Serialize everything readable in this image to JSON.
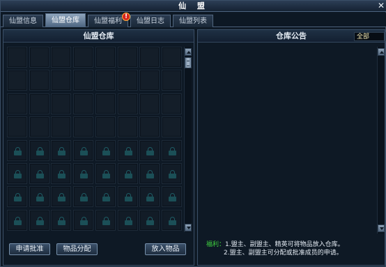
{
  "window": {
    "title": "仙 盟",
    "close_glyph": "✕"
  },
  "tabs": [
    {
      "label": "仙盟信息",
      "active": false
    },
    {
      "label": "仙盟仓库",
      "active": true
    },
    {
      "label": "仙盟福利",
      "active": false,
      "badge": "!"
    },
    {
      "label": "仙盟日志",
      "active": false
    },
    {
      "label": "仙盟列表",
      "active": false
    }
  ],
  "warehouse": {
    "title": "仙盟仓库",
    "rows": 8,
    "cols": 8,
    "unlocked_rows": 4,
    "buttons": {
      "approve": "申请批准",
      "distribute": "物品分配",
      "deposit": "放入物品"
    }
  },
  "notice": {
    "title": "仓库公告",
    "filter_value": "全部",
    "tips_label": "福利：",
    "tips_line1": "1.盟主、副盟主、精英可将物品放入仓库。",
    "tips_line2": "2.盟主、副盟主可分配或批准成员的申请。"
  },
  "colors": {
    "tips_label": "#3fd13f",
    "badge": "#d8251c",
    "active_tab": "#6f86a0"
  }
}
